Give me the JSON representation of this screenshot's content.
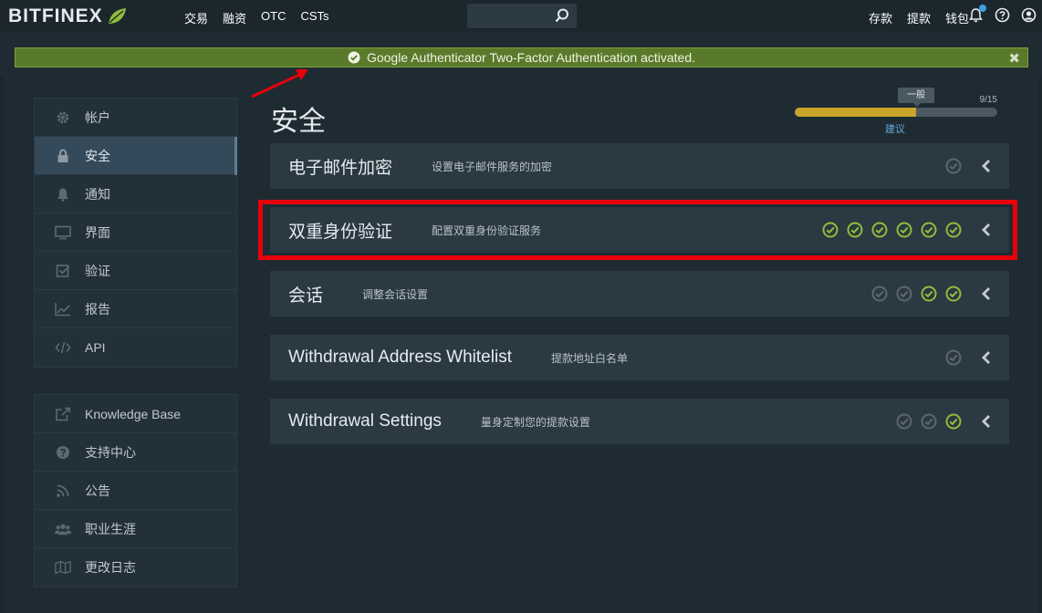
{
  "nav": {
    "logo": "BITFINEX",
    "links": [
      "交易",
      "融资",
      "OTC",
      "CSTs"
    ],
    "search_placeholder": "",
    "right_links": [
      "存款",
      "提款",
      "钱包"
    ]
  },
  "banner": {
    "message": "Google Authenticator Two-Factor Authentication activated.",
    "close": "✖"
  },
  "sidebar_main": [
    {
      "label": "帐户",
      "icon": "gear-icon"
    },
    {
      "label": "安全",
      "icon": "lock-icon",
      "active": true
    },
    {
      "label": "通知",
      "icon": "bell-icon"
    },
    {
      "label": "界面",
      "icon": "monitor-icon"
    },
    {
      "label": "验证",
      "icon": "checkbox-icon"
    },
    {
      "label": "报告",
      "icon": "chart-icon"
    },
    {
      "label": "API",
      "icon": "code-icon"
    }
  ],
  "sidebar_secondary": [
    {
      "label": "Knowledge Base",
      "icon": "external-link-icon"
    },
    {
      "label": "支持中心",
      "icon": "help-icon"
    },
    {
      "label": "公告",
      "icon": "rss-icon"
    },
    {
      "label": "职业生涯",
      "icon": "users-icon"
    },
    {
      "label": "更改日志",
      "icon": "map-icon"
    }
  ],
  "page": {
    "title": "安全"
  },
  "progress": {
    "tip": "一般",
    "count": "9/15",
    "fraction": 0.6,
    "label": "建议"
  },
  "cards": [
    {
      "title": "电子邮件加密",
      "desc": "设置电子邮件服务的加密",
      "status": [
        false
      ]
    },
    {
      "title": "双重身份验证",
      "desc": "配置双重身份验证服务",
      "status": [
        true,
        true,
        true,
        true,
        true,
        true
      ]
    },
    {
      "title": "会话",
      "desc": "调整会话设置",
      "status": [
        false,
        false,
        true,
        true
      ]
    },
    {
      "title": "Withdrawal Address Whitelist",
      "desc": "提款地址白名单",
      "status": [
        false
      ]
    },
    {
      "title": "Withdrawal Settings",
      "desc": "量身定制您的提款设置",
      "status": [
        false,
        false,
        true
      ]
    }
  ],
  "colors": {
    "check_on": "#8fbc3b",
    "check_off": "#5c676f",
    "banner_bg": "#5a7a2b",
    "highlight": "#e8000b",
    "progress_fill": "#c8a52b"
  }
}
